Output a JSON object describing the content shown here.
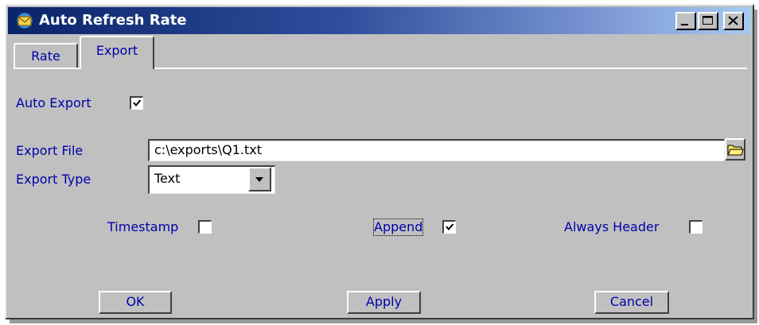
{
  "window": {
    "title": "Auto Refresh Rate",
    "icon": "app-envelope-icon",
    "controls": [
      "minimize-icon",
      "maximize-icon",
      "close-icon"
    ]
  },
  "tabs": [
    {
      "label": "Rate",
      "active": false
    },
    {
      "label": "Export",
      "active": true
    }
  ],
  "export": {
    "auto_export": {
      "label": "Auto Export",
      "checked": true
    },
    "file": {
      "label": "Export File",
      "value": "c:\\exports\\Q1.txt",
      "browse_icon": "folder-icon"
    },
    "type": {
      "label": "Export Type",
      "value": "Text"
    },
    "options": [
      {
        "label": "Timestamp",
        "checked": false
      },
      {
        "label": "Append",
        "checked": true,
        "focused": true
      },
      {
        "label": "Always Header",
        "checked": false
      }
    ]
  },
  "buttons": {
    "ok": "OK",
    "apply": "Apply",
    "cancel": "Cancel"
  },
  "colors": {
    "label_text": "#0000aa",
    "title_gradient_start": "#0a246a",
    "title_gradient_end": "#a6caf0",
    "face": "#c0c0c0"
  }
}
